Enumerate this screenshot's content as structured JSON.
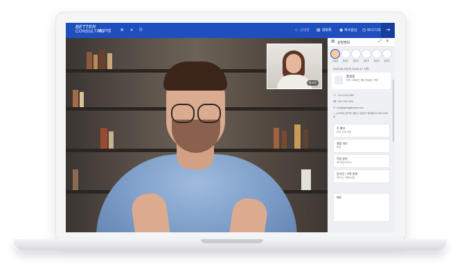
{
  "topbar": {
    "logo_line1": "BETTER",
    "logo_line2": "CONSULTING",
    "brand_text": "매니저앱",
    "items": [
      {
        "label": "상대방",
        "icon": "person-icon"
      },
      {
        "label": "대화록",
        "icon": "document-icon"
      },
      {
        "label": "박서윤님",
        "icon": "user-circle-icon"
      },
      {
        "label": "00:17:23",
        "icon": "clock-icon"
      }
    ]
  },
  "video": {
    "pip_label": "박서윤"
  },
  "panel": {
    "title": "상담정보",
    "participants": [
      "홍길동",
      "참여자",
      "참여자",
      "참여자",
      "참여자",
      "참여자"
    ],
    "date_line": "2023.08.23(수) 02:00:17 시작",
    "profile": {
      "name": "홍길동",
      "info": "남자, 1985년 3월 29일생 / 미혼"
    },
    "contacts": [
      {
        "icon": "phone-icon",
        "text": "010-1234-4567"
      },
      {
        "icon": "tel-icon",
        "text": "031-735-7234"
      },
      {
        "icon": "mail-icon",
        "text": "hongilgdong@naver.com"
      },
      {
        "icon": "home-icon",
        "text": "(12345) 경기도 성남시 분당구 정자동 00 000-1357호"
      }
    ],
    "cards": [
      {
        "title": "주 예약",
        "value": "대인 관계 상담"
      },
      {
        "title": "결혼 여부",
        "value": "미혼"
      },
      {
        "title": "직업 분야",
        "value": "회사원(사무직)"
      },
      {
        "title": "동거인 / 가족 관계",
        "value": "부모님 / 형제(1명)"
      },
      {
        "title": "메모",
        "value": ""
      }
    ]
  }
}
